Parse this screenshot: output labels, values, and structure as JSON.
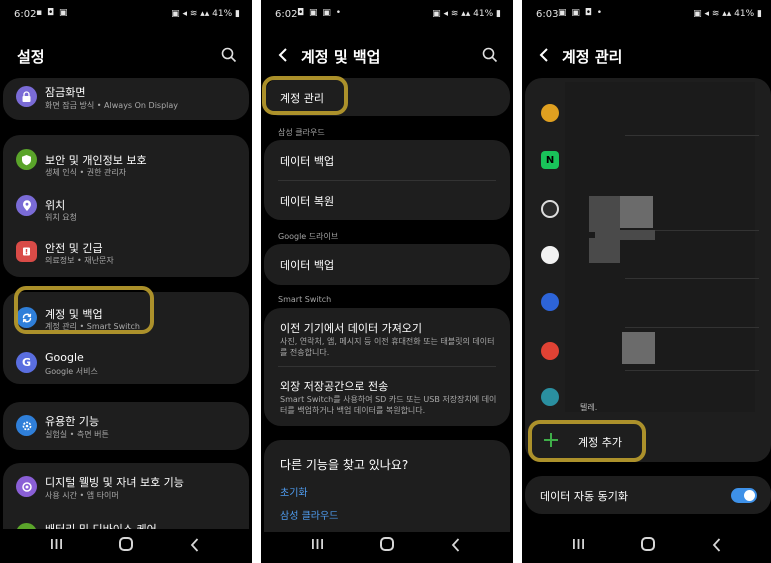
{
  "screen1": {
    "status_time": "6:02",
    "status_battery": "41%",
    "title": "설정",
    "items": [
      {
        "title": "잠금화면",
        "subtitle": "화면 잠금 방식 • Always On Display",
        "icon": "lock-icon",
        "color": "#7a6bd6"
      },
      {
        "title": "보안 및 개인정보 보호",
        "subtitle": "생체 인식 • 권한 관리자",
        "icon": "shield-icon",
        "color": "#5aa42a"
      },
      {
        "title": "위치",
        "subtitle": "위치 요청",
        "icon": "location-pin-icon",
        "color": "#7a6bd6"
      },
      {
        "title": "안전 및 긴급",
        "subtitle": "의료정보 • 재난문자",
        "icon": "emergency-icon",
        "color": "#d94b47"
      },
      {
        "title": "계정 및 백업",
        "subtitle": "계정 관리 • Smart Switch",
        "icon": "sync-icon",
        "color": "#2f7fd9"
      },
      {
        "title": "Google",
        "subtitle": "Google 서비스",
        "icon": "google-g-icon",
        "color": "#5a6ee0"
      },
      {
        "title": "유용한 기능",
        "subtitle": "실험실 • 측면 버튼",
        "icon": "gear-plus-icon",
        "color": "#2f7fd9"
      },
      {
        "title": "디지털 웰빙 및 자녀 보호 기능",
        "subtitle": "사용 시간 • 앱 타이머",
        "icon": "wellbeing-icon",
        "color": "#8a5fd6"
      },
      {
        "title": "배터리 및 디바이스 케어",
        "subtitle": "",
        "icon": "battery-care-icon",
        "color": "#5aa42a"
      }
    ]
  },
  "screen2": {
    "status_time": "6:02",
    "status_battery": "41%",
    "title": "계정 및 백업",
    "account_manage": "계정 관리",
    "section_samsung": "삼성 클라우드",
    "backup": "데이터 백업",
    "restore": "데이터 복원",
    "section_google": "Google 드라이브",
    "google_backup": "데이터 백업",
    "section_smart": "Smart Switch",
    "import_title": "이전 기기에서 데이터 가져오기",
    "import_desc": "사진, 연락처, 앱, 메시지 등 이전 휴대전화 또는 태블릿의 데이터를 전송합니다.",
    "external_title": "외장 저장공간으로 전송",
    "external_desc": "Smart Switch를 사용하여 SD 카드 또는 USB 저장장치에 데이터를 백업하거나 백업 데이터를 복원합니다.",
    "more_title": "다른 기능을 찾고 있나요?",
    "link_reset": "초기화",
    "link_cloud": "삼성 클라우드"
  },
  "screen3": {
    "status_time": "6:03",
    "status_battery": "41%",
    "title": "계정 관리",
    "partial_text": "텔레.",
    "add_account": "계정 추가",
    "auto_sync": "데이터 자동 동기화",
    "account_icons": [
      {
        "icon": "colorful-ring-app-icon",
        "color": "#e0a020"
      },
      {
        "icon": "naver-n-icon",
        "color": "#19c35a"
      },
      {
        "icon": "dark-round-app-icon",
        "color": "#2b2b2b"
      },
      {
        "icon": "white-round-app-icon",
        "color": "#f2f2f2"
      },
      {
        "icon": "blue-round-app-icon",
        "color": "#2d64d8"
      },
      {
        "icon": "red-round-app-icon",
        "color": "#e04234"
      },
      {
        "icon": "teal-round-app-icon",
        "color": "#2a8fa0"
      }
    ],
    "auto_sync_on": true
  },
  "colors": {
    "card": "#1e1e1e",
    "highlight": "#b89b2c",
    "link": "#4f9cf0",
    "toggle": "#3e91e8",
    "add_plus": "#3fae49"
  }
}
